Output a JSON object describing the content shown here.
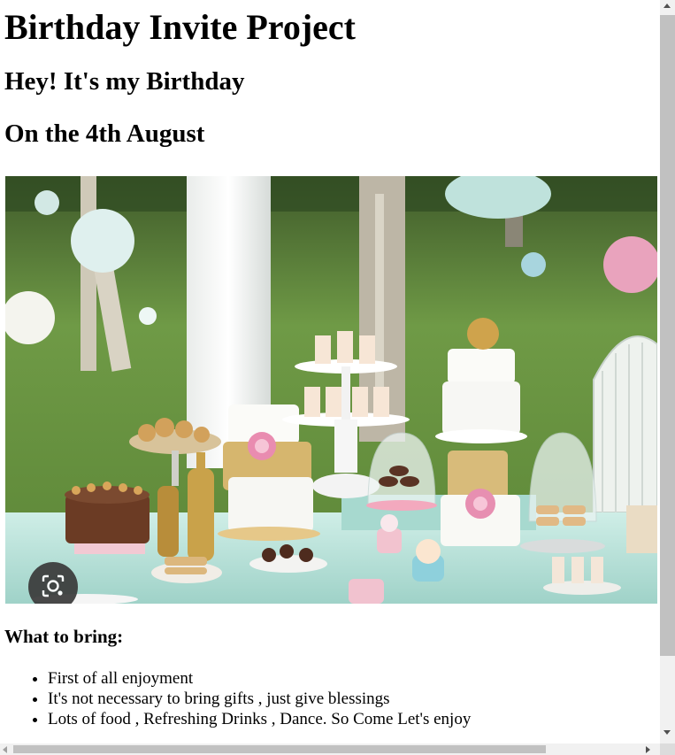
{
  "page": {
    "title": "Birthday Invite Project",
    "greeting": "Hey! It's my Birthday",
    "date_line": "On the 4th August"
  },
  "image": {
    "alt": "Birthday party dessert table with cakes and cupcakes outdoors",
    "lens_icon": "camera-search-icon"
  },
  "bring": {
    "heading": "What to bring:",
    "items": [
      "First of all enjoyment",
      "It's not necessary to bring gifts , just give blessings",
      "Lots of food , Refreshing Drinks , Dance. So Come Let's enjoy"
    ]
  },
  "colors": {
    "scrollbar_track": "#f1f1f1",
    "scrollbar_thumb": "#c1c1c1",
    "grass": "#5f8f3a",
    "tablecloth": "#bfe3dc"
  }
}
